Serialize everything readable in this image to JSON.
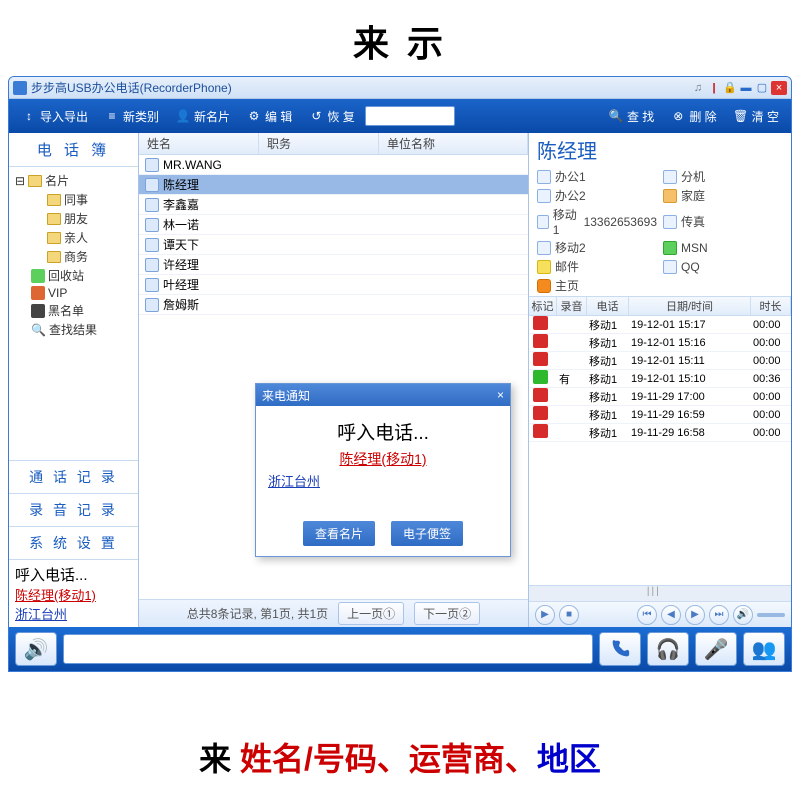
{
  "banner_top": "来                        示",
  "banner_bottom": {
    "b": "来    ",
    "name": "姓名/号码、",
    "carrier": "运营商、",
    "region": "地区"
  },
  "window": {
    "title": "步步高USB办公电话(RecorderPhone)"
  },
  "toolbar": {
    "import": "导入导出",
    "newcat": "新类别",
    "newcard": "新名片",
    "edit": "编 辑",
    "restore": "恢 复",
    "find": "查 找",
    "delete": "删 除",
    "clear": "清 空"
  },
  "left": {
    "tab_phonebook": "电 话 簿",
    "tree": {
      "root": "名片",
      "colleague": "同事",
      "friend": "朋友",
      "relative": "亲人",
      "business": "商务",
      "recycle": "回收站",
      "vip": "VIP",
      "blacklist": "黑名单",
      "results": "查找结果"
    },
    "tab_callrec": "通 话 记 录",
    "tab_recrec": "录 音 记 录",
    "tab_sys": "系 统 设 置",
    "callinfo": {
      "l1": "呼入电话...",
      "l2": "陈经理(移动1)",
      "l3": "浙江台州"
    }
  },
  "mid": {
    "cols": {
      "name": "姓名",
      "title": "职务",
      "company": "单位名称"
    },
    "rows": [
      "MR.WANG",
      "陈经理",
      "李鑫嘉",
      "林一诺",
      "谭天下",
      "许经理",
      "叶经理",
      "詹姆斯"
    ],
    "selected": 1,
    "pager": {
      "info": "总共8条记录, 第1页, 共1页",
      "prev": "上一页①",
      "next": "下一页②"
    }
  },
  "right": {
    "name": "陈经理",
    "fields": [
      {
        "icon": "card",
        "label": "办公1"
      },
      {
        "icon": "card",
        "label": "分机"
      },
      {
        "icon": "card",
        "label": "办公2"
      },
      {
        "icon": "home",
        "label": "家庭"
      },
      {
        "icon": "mob",
        "label": "移动1",
        "val": "13362653693"
      },
      {
        "icon": "fax",
        "label": "传真"
      },
      {
        "icon": "mob",
        "label": "移动2"
      },
      {
        "icon": "msn",
        "label": "MSN"
      },
      {
        "icon": "mail",
        "label": "邮件"
      },
      {
        "icon": "qq",
        "label": "QQ"
      },
      {
        "icon": "rss",
        "label": "主页"
      },
      {
        "icon": "",
        "label": ""
      }
    ],
    "log_cols": {
      "mark": "标记",
      "rec": "录音",
      "phone": "电话",
      "dt": "日期/时间",
      "dur": "时长"
    },
    "logs": [
      {
        "m": "red",
        "r": "",
        "p": "移动1",
        "d": "19-12-01 15:17",
        "t": "00:00"
      },
      {
        "m": "red",
        "r": "",
        "p": "移动1",
        "d": "19-12-01 15:16",
        "t": "00:00"
      },
      {
        "m": "red",
        "r": "",
        "p": "移动1",
        "d": "19-12-01 15:11",
        "t": "00:00"
      },
      {
        "m": "grn",
        "r": "有",
        "p": "移动1",
        "d": "19-12-01 15:10",
        "t": "00:36"
      },
      {
        "m": "red",
        "r": "",
        "p": "移动1",
        "d": "19-11-29 17:00",
        "t": "00:00"
      },
      {
        "m": "red",
        "r": "",
        "p": "移动1",
        "d": "19-11-29 16:59",
        "t": "00:00"
      },
      {
        "m": "red",
        "r": "",
        "p": "移动1",
        "d": "19-11-29 16:58",
        "t": "00:00"
      }
    ]
  },
  "popup": {
    "title": "来电通知",
    "heading": "呼入电话...",
    "name": "陈经理(移动1)",
    "loc": "浙江台州",
    "btn_view": "查看名片",
    "btn_note": "电子便签"
  }
}
